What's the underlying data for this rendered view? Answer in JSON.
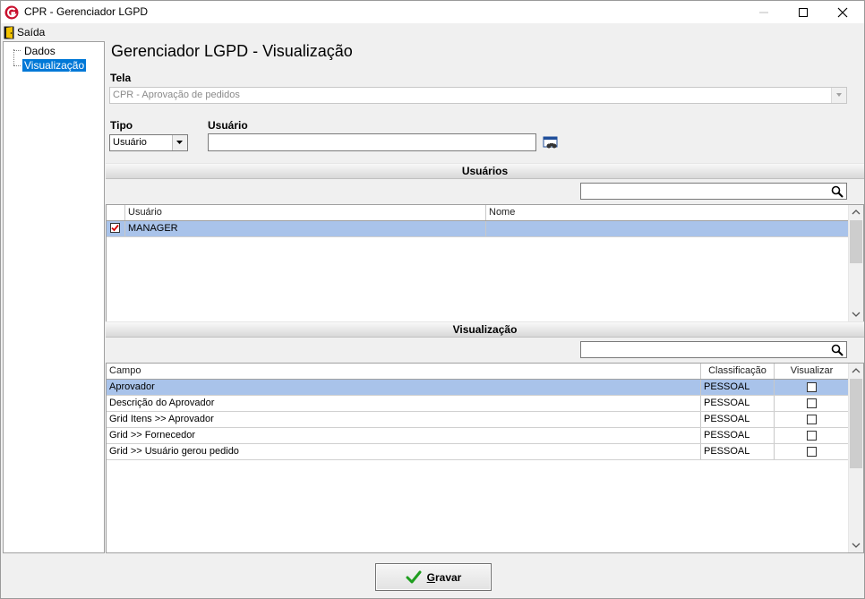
{
  "window": {
    "title": "CPR - Gerenciador LGPD",
    "icon": "app-logo-icon"
  },
  "menu": {
    "exit_label": "Saída",
    "exit_icon": "door-icon"
  },
  "tree": {
    "items": [
      {
        "label": "Dados",
        "selected": false
      },
      {
        "label": "Visualização",
        "selected": true
      }
    ]
  },
  "page": {
    "title": "Gerenciador LGPD - Visualização"
  },
  "form": {
    "tela_label": "Tela",
    "tela_value": "CPR - Aprovação de pedidos",
    "tipo_label": "Tipo",
    "tipo_value": "Usuário",
    "usuario_label": "Usuário",
    "usuario_value": ""
  },
  "users_section": {
    "header": "Usuários",
    "search_value": "",
    "columns": [
      "Usuário",
      "Nome"
    ],
    "rows": [
      {
        "checked": true,
        "usuario": "MANAGER",
        "nome": "",
        "selected": true
      }
    ]
  },
  "view_section": {
    "header": "Visualização",
    "search_value": "",
    "columns": [
      "Campo",
      "Classificação",
      "Visualizar"
    ],
    "rows": [
      {
        "campo": "Aprovador",
        "classificacao": "PESSOAL",
        "visualizar": false,
        "selected": true
      },
      {
        "campo": "Descrição do Aprovador",
        "classificacao": "PESSOAL",
        "visualizar": false,
        "selected": false
      },
      {
        "campo": "Grid  Itens >> Aprovador",
        "classificacao": "PESSOAL",
        "visualizar": false,
        "selected": false
      },
      {
        "campo": "Grid >> Fornecedor",
        "classificacao": "PESSOAL",
        "visualizar": false,
        "selected": false
      },
      {
        "campo": "Grid >> Usuário gerou pedido",
        "classificacao": "PESSOAL",
        "visualizar": false,
        "selected": false
      }
    ]
  },
  "actions": {
    "save_label": "Gravar",
    "save_underline": "G",
    "save_rest": "ravar"
  },
  "colors": {
    "selection": "#a9c3ea",
    "tree_selection": "#0078d7",
    "check_red": "#d40000",
    "check_green": "#1f9e1f"
  }
}
